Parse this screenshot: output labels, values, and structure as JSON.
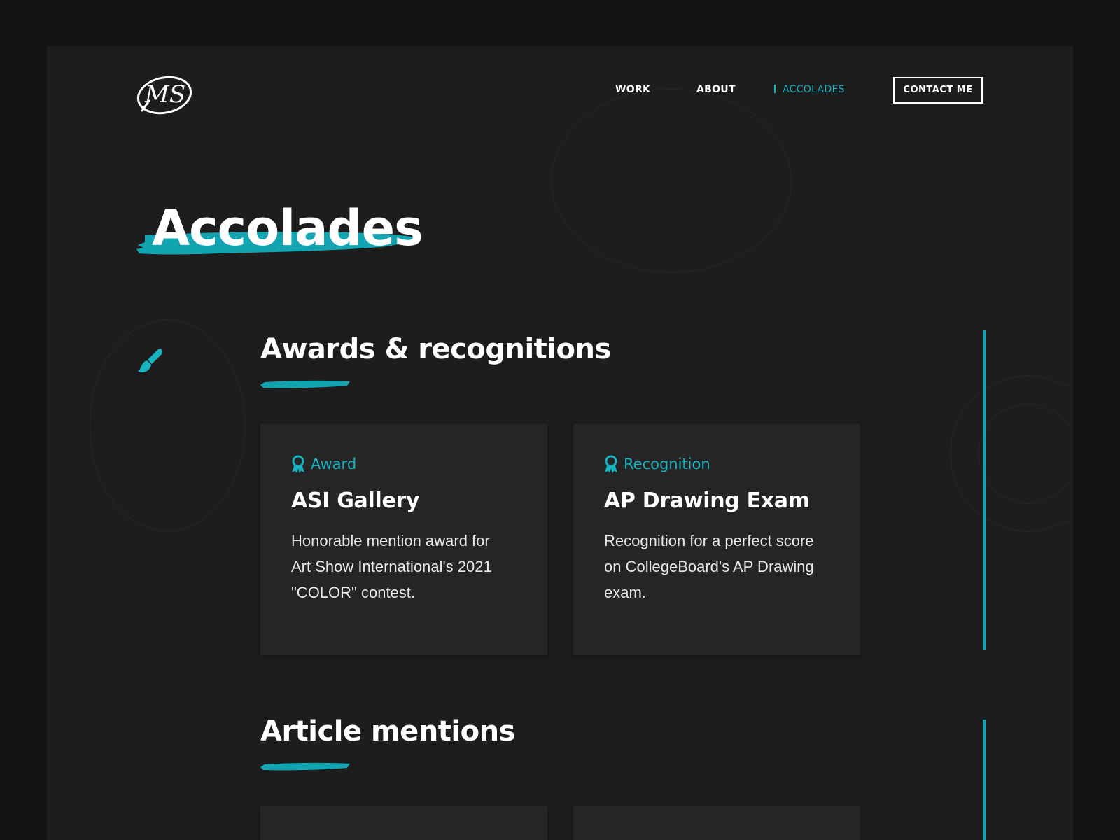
{
  "nav": {
    "logo_text": "MS",
    "items": [
      {
        "label": "WORK",
        "active": false
      },
      {
        "label": "ABOUT",
        "active": false
      },
      {
        "label": "ACCOLADES",
        "active": true
      }
    ],
    "contact_label": "CONTACT ME"
  },
  "page": {
    "title": "Accolades"
  },
  "sections": [
    {
      "title": "Awards & recognitions",
      "icon": "paintbrush-icon",
      "cards": [
        {
          "badge_icon": "ribbon-icon",
          "badge": "Award",
          "title": "ASI Gallery",
          "description": "Honorable mention award for Art Show International's 2021 \"COLOR\" contest."
        },
        {
          "badge_icon": "ribbon-icon",
          "badge": "Recognition",
          "title": "AP Drawing Exam",
          "description": "Recognition for a perfect score on CollegeBoard's AP Drawing exam."
        }
      ]
    },
    {
      "title": "Article mentions",
      "cards": []
    }
  ],
  "colors": {
    "accent": "#17b3c0",
    "background": "#1d1d1d",
    "outer": "#131313",
    "card": "#252525"
  }
}
